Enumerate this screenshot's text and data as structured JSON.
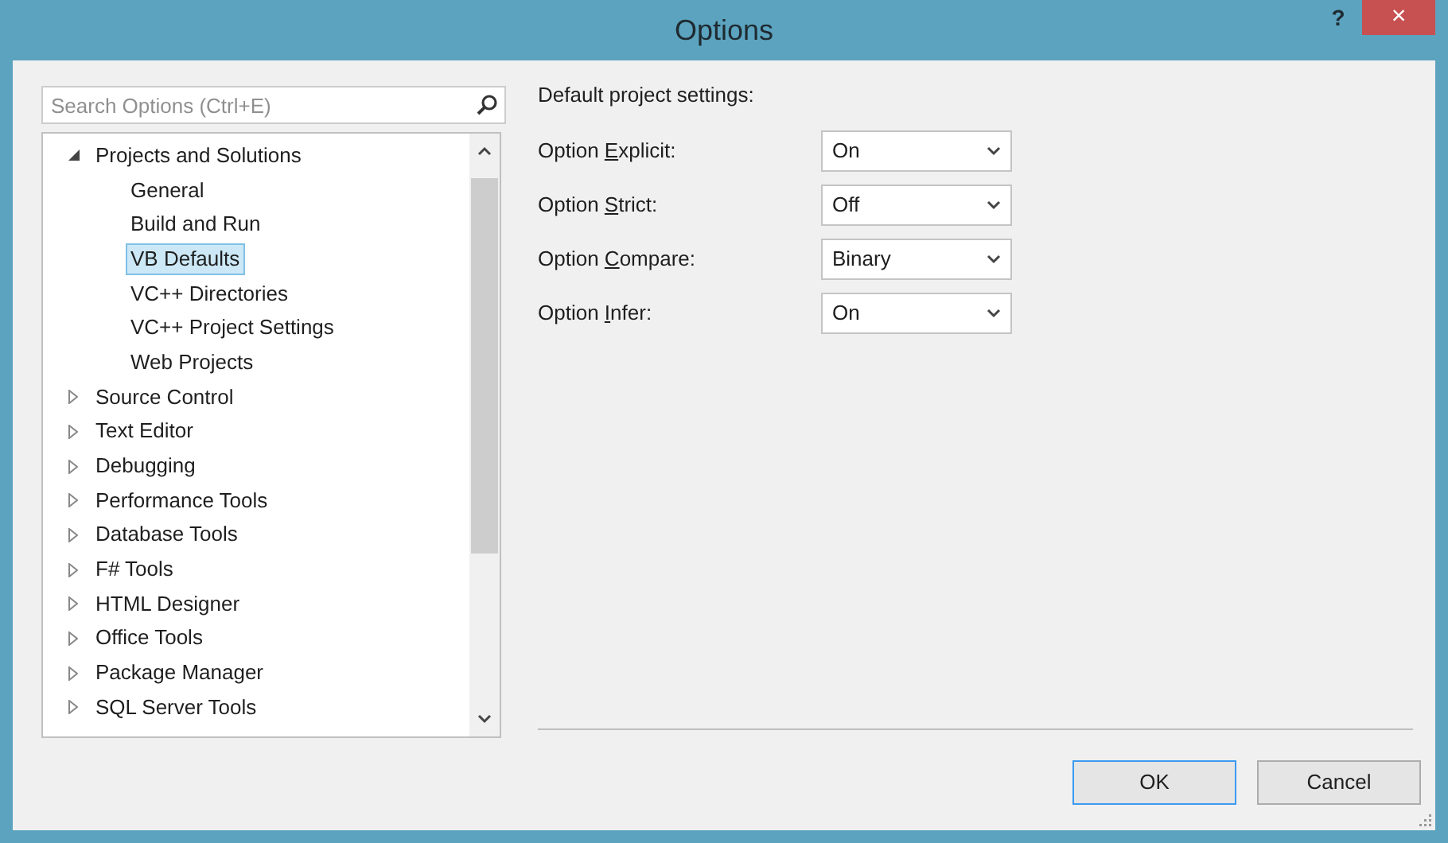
{
  "window": {
    "title": "Options",
    "help": "?",
    "close": "×"
  },
  "search": {
    "placeholder": "Search Options (Ctrl+E)"
  },
  "tree": [
    {
      "label": "Projects and Solutions",
      "expanded": true,
      "selected": false,
      "children": [
        {
          "label": "General",
          "selected": false
        },
        {
          "label": "Build and Run",
          "selected": false
        },
        {
          "label": "VB Defaults",
          "selected": true
        },
        {
          "label": "VC++ Directories",
          "selected": false
        },
        {
          "label": "VC++ Project Settings",
          "selected": false
        },
        {
          "label": "Web Projects",
          "selected": false
        }
      ]
    },
    {
      "label": "Source Control",
      "expanded": false,
      "selected": false
    },
    {
      "label": "Text Editor",
      "expanded": false,
      "selected": false
    },
    {
      "label": "Debugging",
      "expanded": false,
      "selected": false
    },
    {
      "label": "Performance Tools",
      "expanded": false,
      "selected": false
    },
    {
      "label": "Database Tools",
      "expanded": false,
      "selected": false
    },
    {
      "label": "F# Tools",
      "expanded": false,
      "selected": false
    },
    {
      "label": "HTML Designer",
      "expanded": false,
      "selected": false
    },
    {
      "label": "Office Tools",
      "expanded": false,
      "selected": false
    },
    {
      "label": "Package Manager",
      "expanded": false,
      "selected": false
    },
    {
      "label": "SQL Server Tools",
      "expanded": false,
      "selected": false
    }
  ],
  "section_title": "Default project settings:",
  "settings": [
    {
      "label_before": "Option ",
      "access_key": "E",
      "label_after": "xplicit:",
      "value": "On"
    },
    {
      "label_before": "Option ",
      "access_key": "S",
      "label_after": "trict:",
      "value": "Off"
    },
    {
      "label_before": "Option ",
      "access_key": "C",
      "label_after": "ompare:",
      "value": "Binary"
    },
    {
      "label_before": "Option ",
      "access_key": "I",
      "label_after": "nfer:",
      "value": "On"
    }
  ],
  "buttons": [
    {
      "label": "OK",
      "default": true
    },
    {
      "label": "Cancel",
      "default": false
    }
  ]
}
